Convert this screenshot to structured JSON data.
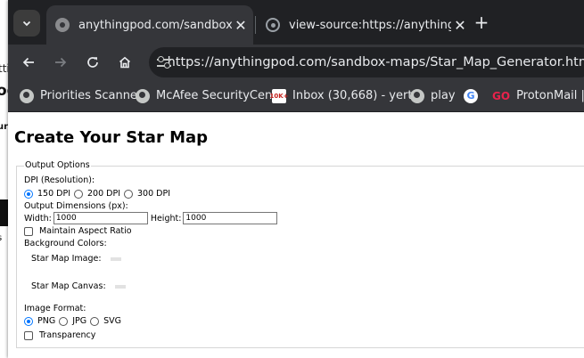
{
  "background_window": {
    "text_1": "ttie",
    "text_2": "oc",
    "text_3": "ur",
    "text_4": "s"
  },
  "tabs": [
    {
      "title": "anythingpod.com/sandbox-maps",
      "active": true
    },
    {
      "title": "view-source:https://anythingpod",
      "active": false
    }
  ],
  "toolbar": {
    "tab_search_icon": "chevron-down-icon",
    "close_glyph": "✕",
    "new_tab_glyph": "+",
    "url": "https://anythingpod.com/sandbox-maps/Star_Map_Generator.html"
  },
  "bookmarks": [
    {
      "label": "Priorities Scanner",
      "icon": "globe-icon"
    },
    {
      "label": "McAfee SecurityCen...",
      "icon": "globe-icon"
    },
    {
      "label": "Inbox (30,668) - yert...",
      "icon": "gmail-icon",
      "badge": "10K+"
    },
    {
      "label": "play",
      "icon": "globe-icon"
    },
    {
      "label": "",
      "icon": "google-icon",
      "glyph": "G"
    },
    {
      "label": "ProtonMail | Inc",
      "icon": "proton-icon",
      "glyph": "GO"
    }
  ],
  "page": {
    "title": "Create Your Star Map",
    "output_options": {
      "legend": "Output Options",
      "dpi_label": "DPI (Resolution):",
      "dpi_options": [
        "150 DPI",
        "200 DPI",
        "300 DPI"
      ],
      "dpi_selected": "150 DPI",
      "dimensions_label": "Output Dimensions (px):",
      "width_label": "Width:",
      "width_value": "1000",
      "height_label": "Height:",
      "height_value": "1000",
      "maintain_aspect_label": "Maintain Aspect Ratio",
      "maintain_aspect_checked": false,
      "bg_colors_label": "Background Colors:",
      "star_map_image_label": "Star Map Image:",
      "star_map_canvas_label": "Star Map Canvas:",
      "image_format_label": "Image Format:",
      "format_options": [
        "PNG",
        "JPG",
        "SVG"
      ],
      "format_selected": "PNG",
      "transparency_label": "Transparency",
      "transparency_checked": false
    }
  },
  "colors": {
    "tab_strip": "#202124",
    "toolbar": "#35363a",
    "radio_selected": "#0075ff",
    "swatch": "#e2e2e2"
  }
}
